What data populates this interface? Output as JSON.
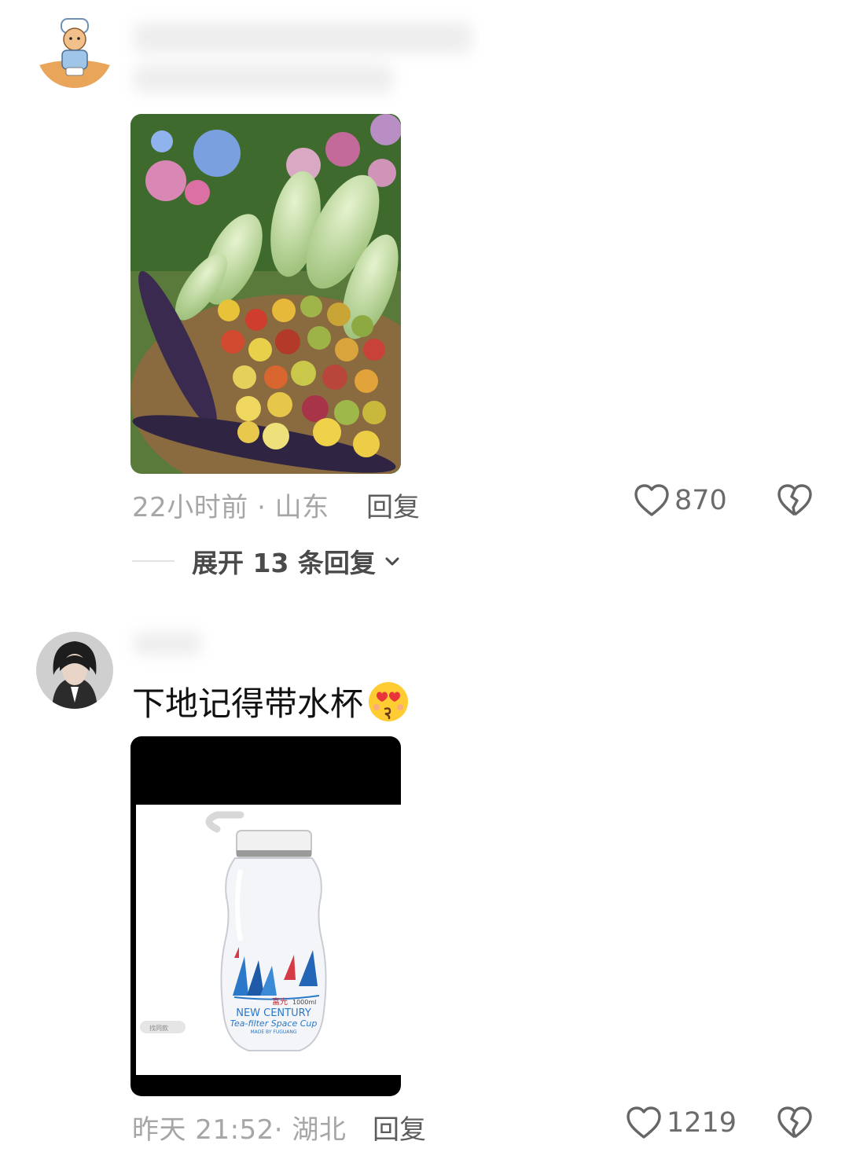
{
  "comments": [
    {
      "avatar": "chef-cartoon-avatar",
      "image": "vegetable-basket-photo",
      "time": "22小时前 · 山东",
      "reply_label": "回复",
      "likes": "870",
      "expand_label": "展开 13 条回复"
    },
    {
      "avatar": "girl-portrait-avatar",
      "text": "下地记得带水杯",
      "emoji": "heart-eyes-kiss-emoji",
      "image": "water-bottle-photo",
      "image_text": {
        "brand": "富光",
        "capacity": "1000ml",
        "line1": "NEW CENTURY",
        "line2": "Tea-filter Space Cup",
        "line3": "MADE BY FUGUANG",
        "search_chip": "找同款"
      },
      "time": "昨天 21:52· 湖北",
      "reply_label": "回复",
      "likes": "1219"
    }
  ],
  "colors": {
    "background": "#ffffff",
    "meta": "#a6a6a6",
    "text": "#111111"
  }
}
